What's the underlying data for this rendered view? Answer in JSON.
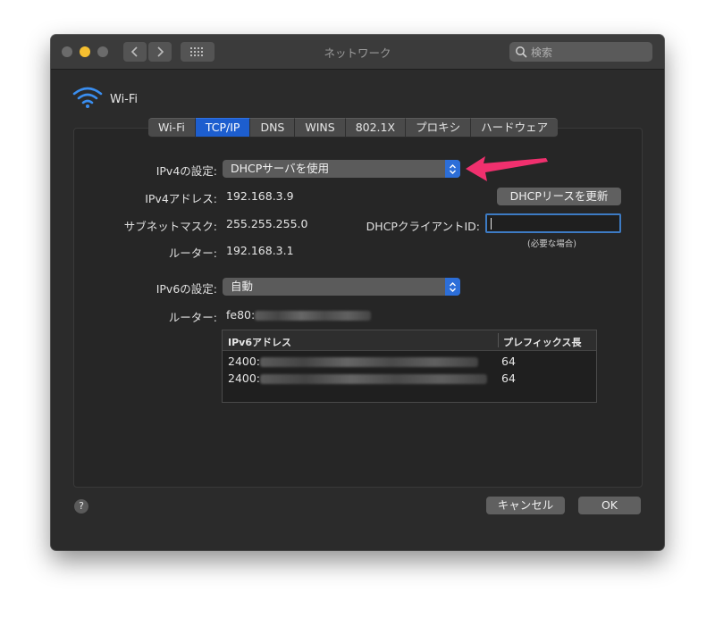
{
  "window": {
    "title": "ネットワーク",
    "search_placeholder": "検索"
  },
  "interface": {
    "name": "Wi-Fi"
  },
  "tabs": [
    {
      "label": "Wi-Fi"
    },
    {
      "label": "TCP/IP"
    },
    {
      "label": "DNS"
    },
    {
      "label": "WINS"
    },
    {
      "label": "802.1X"
    },
    {
      "label": "プロキシ"
    },
    {
      "label": "ハードウェア"
    }
  ],
  "active_tab": "TCP/IP",
  "ipv4": {
    "config_label": "IPv4の設定:",
    "config_value": "DHCPサーバを使用",
    "address_label": "IPv4アドレス:",
    "address_value": "192.168.3.9",
    "subnet_label": "サブネットマスク:",
    "subnet_value": "255.255.255.0",
    "router_label": "ルーター:",
    "router_value": "192.168.3.1",
    "renew_button": "DHCPリースを更新",
    "client_id_label": "DHCPクライアントID:",
    "client_id_value": "",
    "client_id_hint": "(必要な場合)"
  },
  "ipv6": {
    "config_label": "IPv6の設定:",
    "config_value": "自動",
    "router_label": "ルーター:",
    "router_value_prefix": "fe80:",
    "table": {
      "col_address": "IPv6アドレス",
      "col_prefix": "プレフィックス長",
      "rows": [
        {
          "address_prefix": "2400:",
          "prefix_length": "64"
        },
        {
          "address_prefix": "2400:",
          "prefix_length": "64"
        }
      ]
    }
  },
  "footer": {
    "help": "?",
    "cancel_button": "キャンセル",
    "ok_button": "OK"
  },
  "colors": {
    "accent": "#1d5ecf",
    "annotation_arrow": "#f0306e",
    "window_bg": "#2b2b2b"
  }
}
